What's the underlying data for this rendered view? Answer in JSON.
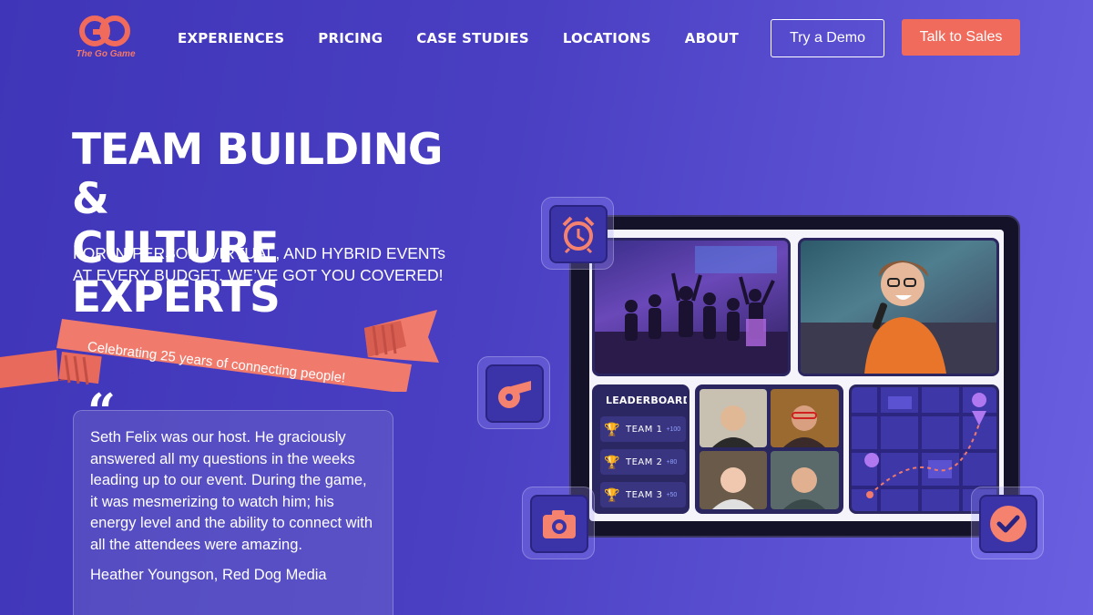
{
  "brand": {
    "logo_text": "The Go Game",
    "accent": "#f06b5c"
  },
  "nav": {
    "items": [
      {
        "label": "EXPERIENCES"
      },
      {
        "label": "PRICING"
      },
      {
        "label": "CASE STUDIES"
      },
      {
        "label": "LOCATIONS"
      },
      {
        "label": "ABOUT"
      }
    ],
    "demo_button": "Try a Demo",
    "sales_button": "Talk to Sales"
  },
  "hero": {
    "title_line1": "TEAM BUILDING &",
    "title_line2": "CULTURE EXPERTS",
    "subtitle_line1": "FOR IN-PERSON, VIRTUAL, AND HYBRID EVENTs",
    "subtitle_line2": "AT EVERY BUDGET. WE’VE GOT YOU COVERED!",
    "ribbon": "Celebrating 25 years of connecting people!"
  },
  "testimonial": {
    "quote_mark": "“",
    "text": "Seth Felix was our host. He graciously answered all my questions in the weeks leading up to our event. During the game, it was mesmerizing to watch him; his energy level and the ability to connect with all the attendees were amazing.",
    "author": "Heather Youngson, Red Dog Media"
  },
  "leaderboard": {
    "title": "LEADERBOARD",
    "rows": [
      {
        "team": "TEAM 1",
        "points": "+100",
        "trophy_color": "#f0b43c"
      },
      {
        "team": "TEAM 2",
        "points": "+80",
        "trophy_color": "#b8c0d8"
      },
      {
        "team": "TEAM 3",
        "points": "+50",
        "trophy_color": "#d98a4c"
      }
    ]
  },
  "icons": {
    "alarm": "alarm-clock-icon",
    "whistle": "whistle-icon",
    "camera": "camera-icon",
    "check": "checkmark-icon"
  }
}
